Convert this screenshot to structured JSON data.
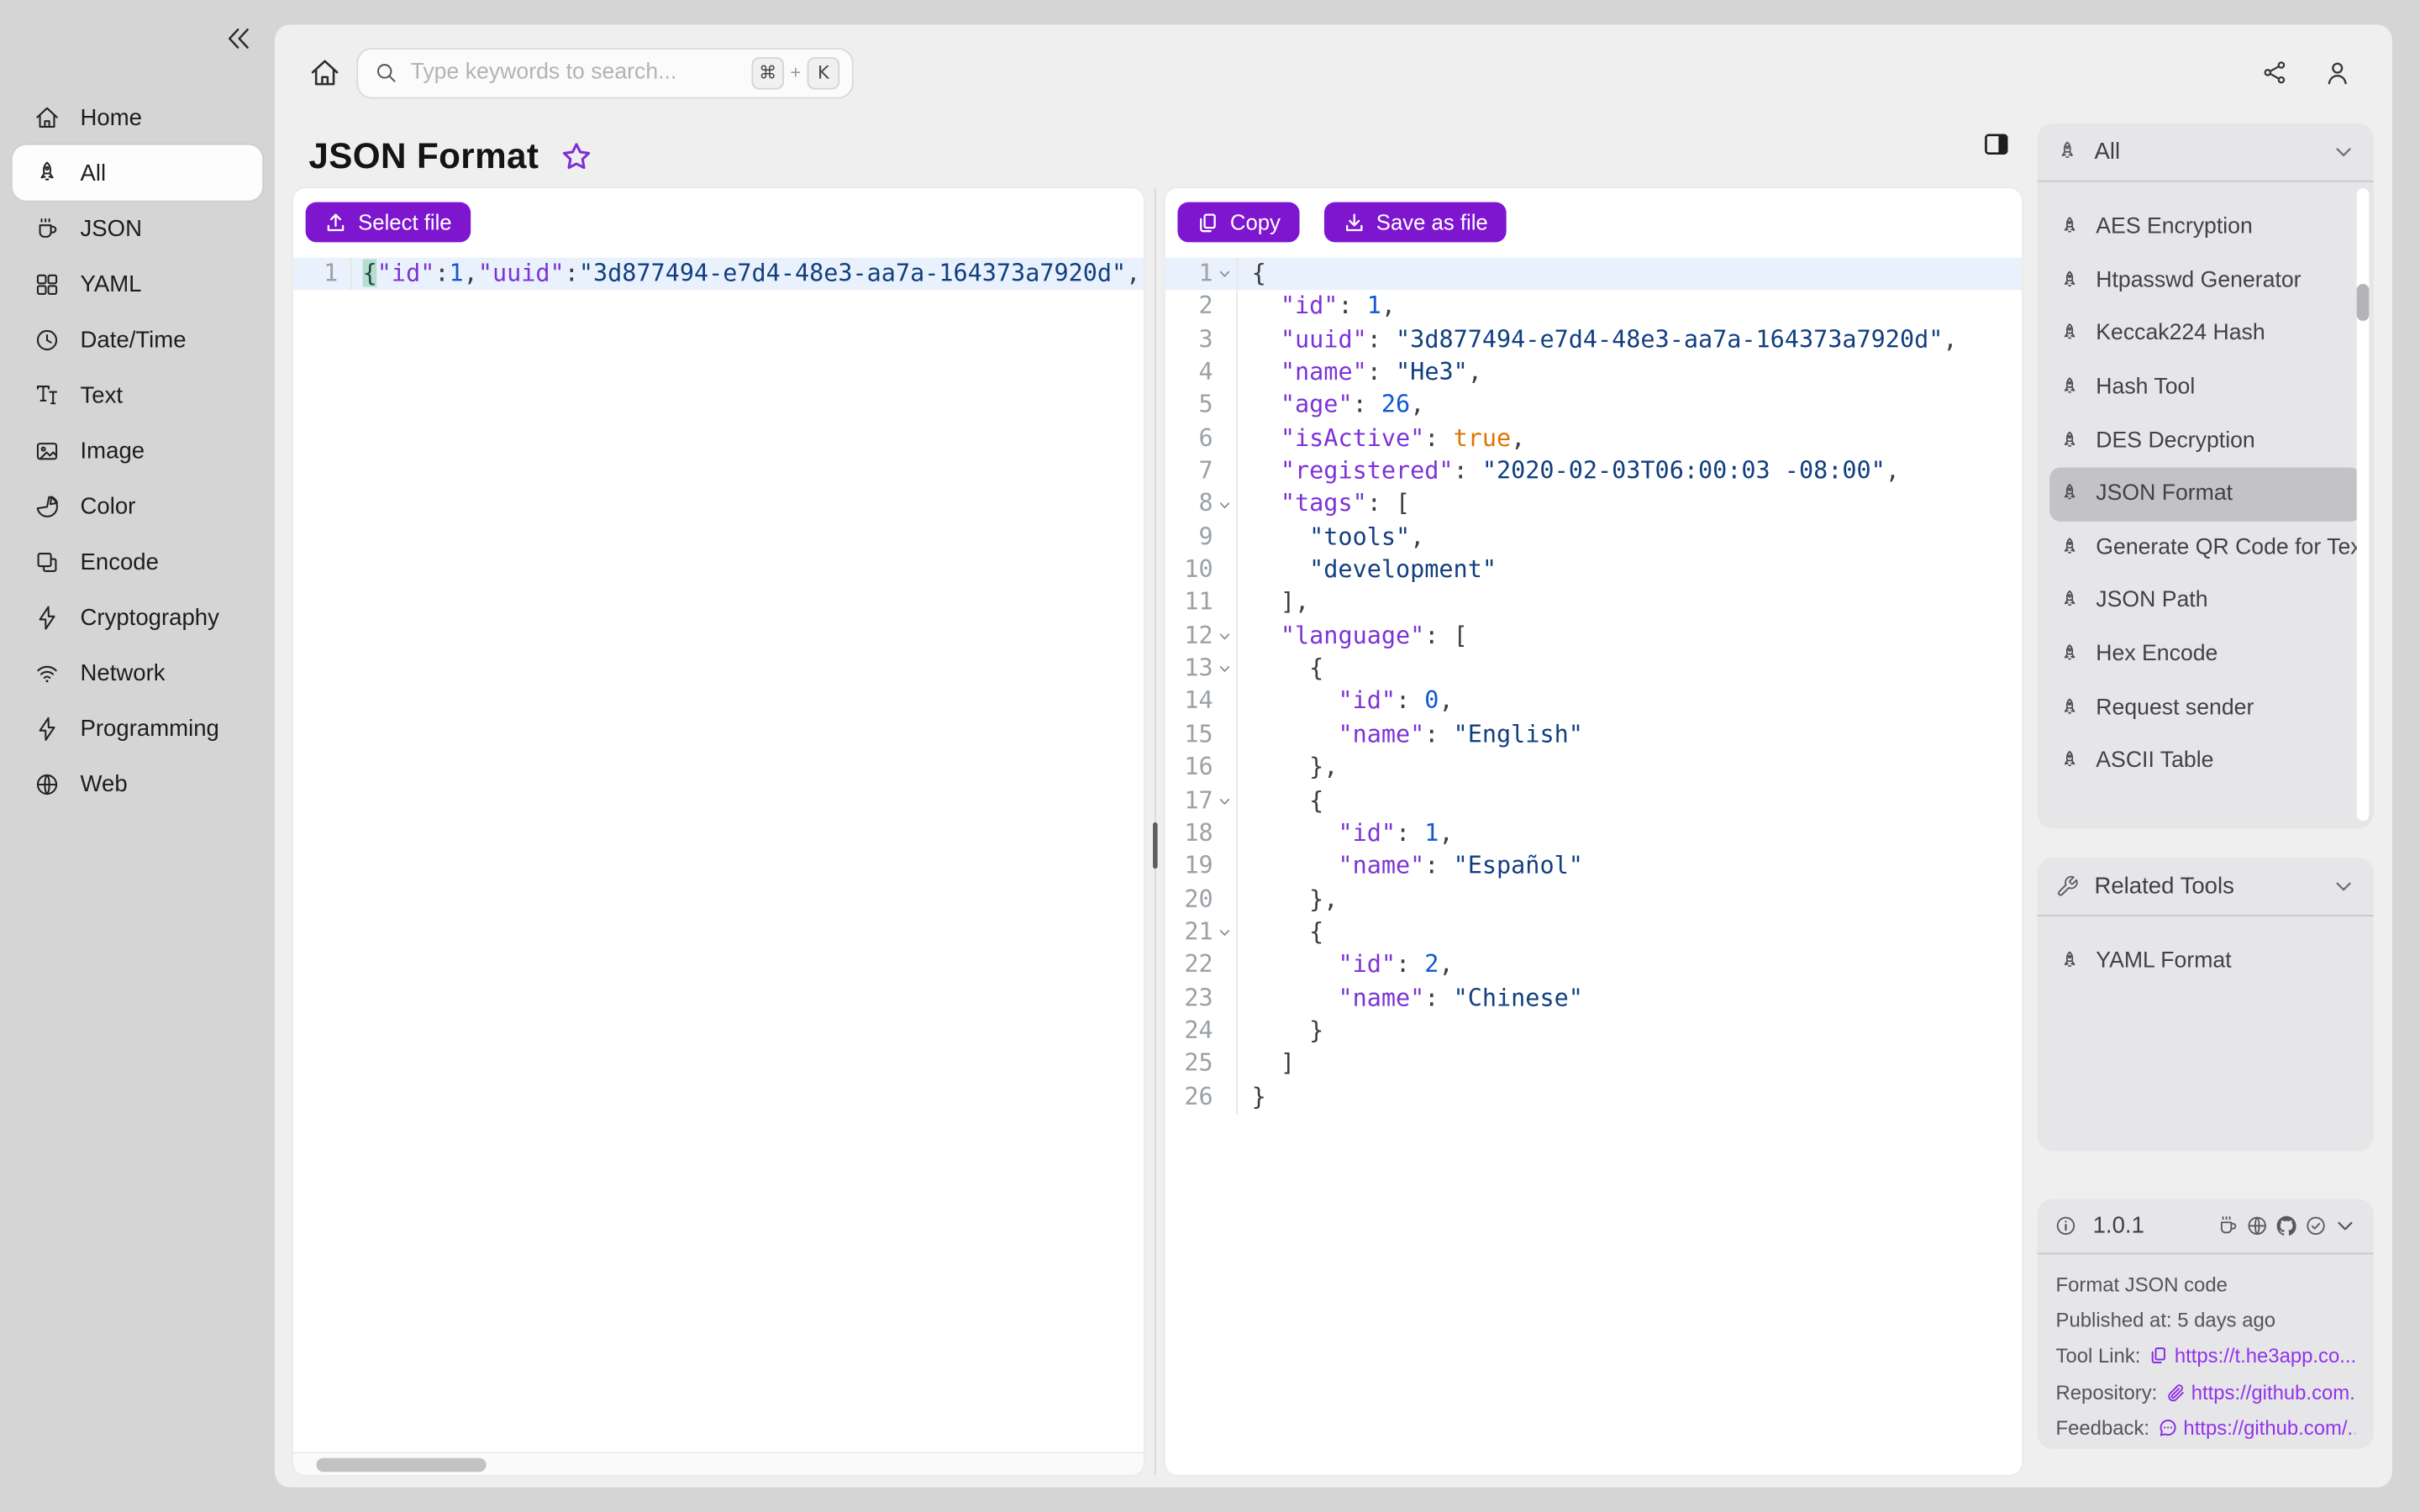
{
  "colors": {
    "accent": "#7e16cf",
    "link": "#9333ea",
    "selected_item_bg": "#c3c3c5",
    "active_line_bg": "#e9f2fc",
    "window_bg": "#d5d5d6",
    "panel_bg": "#efefef"
  },
  "sidebar": {
    "collapse_icon": "double-chevron-left",
    "items": [
      {
        "label": "Home",
        "icon": "home",
        "active": false
      },
      {
        "label": "All",
        "icon": "rocket",
        "active": true
      },
      {
        "label": "JSON",
        "icon": "mug",
        "active": false
      },
      {
        "label": "YAML",
        "icon": "grid",
        "active": false
      },
      {
        "label": "Date/Time",
        "icon": "clock",
        "active": false
      },
      {
        "label": "Text",
        "icon": "text",
        "active": false
      },
      {
        "label": "Image",
        "icon": "image",
        "active": false
      },
      {
        "label": "Color",
        "icon": "pie",
        "active": false
      },
      {
        "label": "Encode",
        "icon": "layers",
        "active": false
      },
      {
        "label": "Cryptography",
        "icon": "zap",
        "active": false
      },
      {
        "label": "Network",
        "icon": "wifi",
        "active": false
      },
      {
        "label": "Programming",
        "icon": "zap",
        "active": false
      },
      {
        "label": "Web",
        "icon": "globe",
        "active": false
      }
    ]
  },
  "topbar": {
    "search_placeholder": "Type keywords to search...",
    "shortcut_cmd": "⌘",
    "shortcut_plus": "+",
    "shortcut_key": "K"
  },
  "header": {
    "title": "JSON Format"
  },
  "left_editor": {
    "select_file_label": "Select file",
    "lines": [
      {
        "n": 1,
        "fold": false,
        "ind": 0,
        "toks": [
          [
            "m",
            "{"
          ],
          [
            "k",
            "\"id\""
          ],
          [
            "p",
            ":"
          ],
          [
            "n",
            "1"
          ],
          [
            "p",
            ","
          ],
          [
            "k",
            "\"uuid\""
          ],
          [
            "p",
            ":"
          ],
          [
            "s",
            "\"3d877494-e7d4-48e3-aa7a-164373a7920d\""
          ],
          [
            "p",
            ","
          ]
        ]
      }
    ]
  },
  "right_editor": {
    "copy_label": "Copy",
    "save_label": "Save as file",
    "lines": [
      {
        "n": 1,
        "fold": true,
        "ind": 0,
        "toks": [
          [
            "p",
            "{"
          ]
        ]
      },
      {
        "n": 2,
        "fold": false,
        "ind": 2,
        "toks": [
          [
            "k",
            "\"id\""
          ],
          [
            "p",
            ": "
          ],
          [
            "n",
            "1"
          ],
          [
            "p",
            ","
          ]
        ]
      },
      {
        "n": 3,
        "fold": false,
        "ind": 2,
        "toks": [
          [
            "k",
            "\"uuid\""
          ],
          [
            "p",
            ": "
          ],
          [
            "s",
            "\"3d877494-e7d4-48e3-aa7a-164373a7920d\""
          ],
          [
            "p",
            ","
          ]
        ]
      },
      {
        "n": 4,
        "fold": false,
        "ind": 2,
        "toks": [
          [
            "k",
            "\"name\""
          ],
          [
            "p",
            ": "
          ],
          [
            "s",
            "\"He3\""
          ],
          [
            "p",
            ","
          ]
        ]
      },
      {
        "n": 5,
        "fold": false,
        "ind": 2,
        "toks": [
          [
            "k",
            "\"age\""
          ],
          [
            "p",
            ": "
          ],
          [
            "n",
            "26"
          ],
          [
            "p",
            ","
          ]
        ]
      },
      {
        "n": 6,
        "fold": false,
        "ind": 2,
        "toks": [
          [
            "k",
            "\"isActive\""
          ],
          [
            "p",
            ": "
          ],
          [
            "b",
            "true"
          ],
          [
            "p",
            ","
          ]
        ]
      },
      {
        "n": 7,
        "fold": false,
        "ind": 2,
        "toks": [
          [
            "k",
            "\"registered\""
          ],
          [
            "p",
            ": "
          ],
          [
            "s",
            "\"2020-02-03T06:00:03 -08:00\""
          ],
          [
            "p",
            ","
          ]
        ]
      },
      {
        "n": 8,
        "fold": true,
        "ind": 2,
        "toks": [
          [
            "k",
            "\"tags\""
          ],
          [
            "p",
            ": ["
          ]
        ]
      },
      {
        "n": 9,
        "fold": false,
        "ind": 4,
        "toks": [
          [
            "s",
            "\"tools\""
          ],
          [
            "p",
            ","
          ]
        ]
      },
      {
        "n": 10,
        "fold": false,
        "ind": 4,
        "toks": [
          [
            "s",
            "\"development\""
          ]
        ]
      },
      {
        "n": 11,
        "fold": false,
        "ind": 2,
        "toks": [
          [
            "p",
            "],"
          ]
        ]
      },
      {
        "n": 12,
        "fold": true,
        "ind": 2,
        "toks": [
          [
            "k",
            "\"language\""
          ],
          [
            "p",
            ": ["
          ]
        ]
      },
      {
        "n": 13,
        "fold": true,
        "ind": 4,
        "toks": [
          [
            "p",
            "{"
          ]
        ]
      },
      {
        "n": 14,
        "fold": false,
        "ind": 6,
        "toks": [
          [
            "k",
            "\"id\""
          ],
          [
            "p",
            ": "
          ],
          [
            "n",
            "0"
          ],
          [
            "p",
            ","
          ]
        ]
      },
      {
        "n": 15,
        "fold": false,
        "ind": 6,
        "toks": [
          [
            "k",
            "\"name\""
          ],
          [
            "p",
            ": "
          ],
          [
            "s",
            "\"English\""
          ]
        ]
      },
      {
        "n": 16,
        "fold": false,
        "ind": 4,
        "toks": [
          [
            "p",
            "},"
          ]
        ]
      },
      {
        "n": 17,
        "fold": true,
        "ind": 4,
        "toks": [
          [
            "p",
            "{"
          ]
        ]
      },
      {
        "n": 18,
        "fold": false,
        "ind": 6,
        "toks": [
          [
            "k",
            "\"id\""
          ],
          [
            "p",
            ": "
          ],
          [
            "n",
            "1"
          ],
          [
            "p",
            ","
          ]
        ]
      },
      {
        "n": 19,
        "fold": false,
        "ind": 6,
        "toks": [
          [
            "k",
            "\"name\""
          ],
          [
            "p",
            ": "
          ],
          [
            "s",
            "\"Español\""
          ]
        ]
      },
      {
        "n": 20,
        "fold": false,
        "ind": 4,
        "toks": [
          [
            "p",
            "},"
          ]
        ]
      },
      {
        "n": 21,
        "fold": true,
        "ind": 4,
        "toks": [
          [
            "p",
            "{"
          ]
        ]
      },
      {
        "n": 22,
        "fold": false,
        "ind": 6,
        "toks": [
          [
            "k",
            "\"id\""
          ],
          [
            "p",
            ": "
          ],
          [
            "n",
            "2"
          ],
          [
            "p",
            ","
          ]
        ]
      },
      {
        "n": 23,
        "fold": false,
        "ind": 6,
        "toks": [
          [
            "k",
            "\"name\""
          ],
          [
            "p",
            ": "
          ],
          [
            "s",
            "\"Chinese\""
          ]
        ]
      },
      {
        "n": 24,
        "fold": false,
        "ind": 4,
        "toks": [
          [
            "p",
            "}"
          ]
        ]
      },
      {
        "n": 25,
        "fold": false,
        "ind": 2,
        "toks": [
          [
            "p",
            "]"
          ]
        ]
      },
      {
        "n": 26,
        "fold": false,
        "ind": 0,
        "toks": [
          [
            "p",
            "}"
          ]
        ]
      }
    ]
  },
  "tools_panel": {
    "header": "All",
    "selected": "JSON Format",
    "items": [
      "AES Encryption",
      "Htpasswd Generator",
      "Keccak224 Hash",
      "Hash Tool",
      "DES Decryption",
      "JSON Format",
      "Generate QR Code for Text",
      "JSON Path",
      "Hex Encode",
      "Request sender",
      "ASCII Table"
    ]
  },
  "related_panel": {
    "header": "Related Tools",
    "items": [
      "YAML Format"
    ]
  },
  "info_panel": {
    "version": "1.0.1",
    "description": "Format JSON code",
    "published": "Published at: 5 days ago",
    "tool_link_label": "Tool Link:",
    "tool_link": "https://t.he3app.co...",
    "repo_label": "Repository:",
    "repo_link": "https://github.com...",
    "feedback_label": "Feedback:",
    "feedback_link": "https://github.com/..."
  }
}
